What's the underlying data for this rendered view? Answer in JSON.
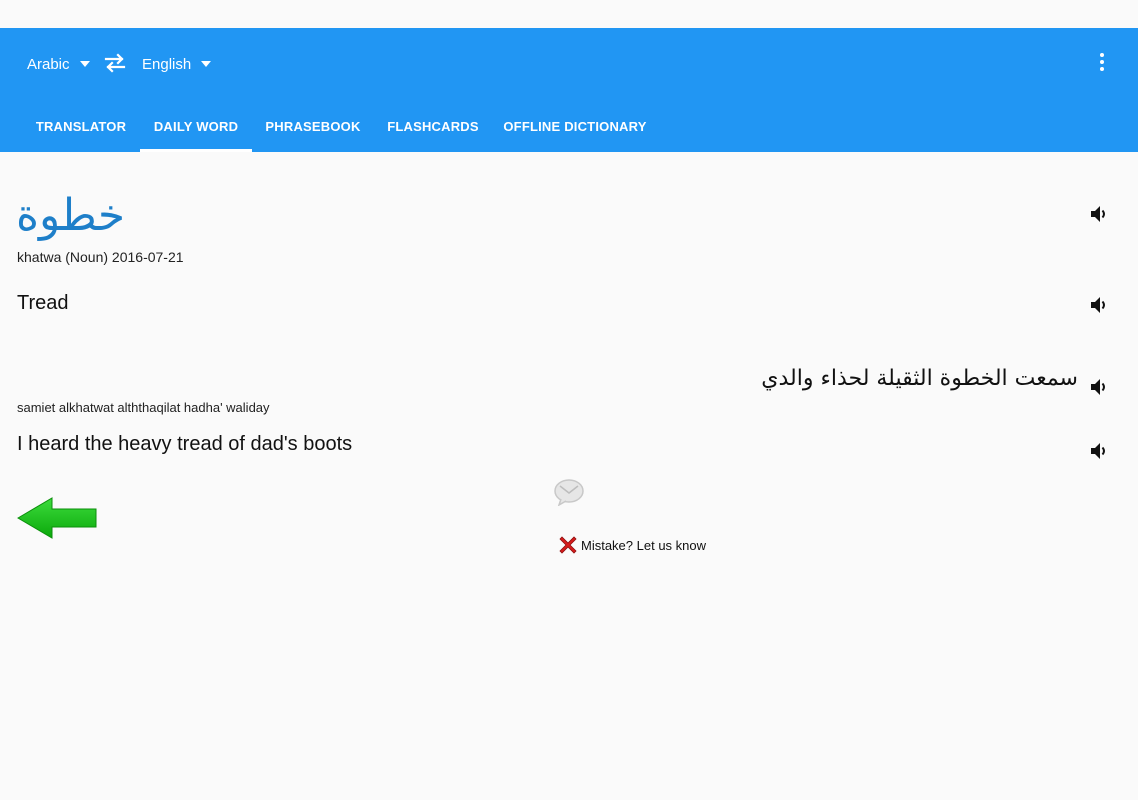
{
  "header": {
    "source_language": "Arabic",
    "target_language": "English",
    "swap_icon": "swap-arrows-icon",
    "overflow_icon": "more-vert-icon",
    "accent_color": "#2196f3"
  },
  "tabs": [
    {
      "label": "TRANSLATOR",
      "active": false
    },
    {
      "label": "DAILY WORD",
      "active": true
    },
    {
      "label": "PHRASEBOOK",
      "active": false
    },
    {
      "label": "FLASHCARDS",
      "active": false
    },
    {
      "label": "OFFLINE DICTIONARY",
      "active": false
    }
  ],
  "daily_word": {
    "word": "خطوة",
    "meta": "khatwa (Noun) 2016-07-21",
    "translation": "Tread",
    "example_arabic": "سمعت الخطوة الثقيلة لحذاء والدي",
    "example_transliteration": "samiet alkhatwat alththaqilat hadha' waliday",
    "example_english": "I heard the heavy tread of dad's boots",
    "speaker_icon": "speaker-icon",
    "word_color": "#1e7fc9"
  },
  "footer": {
    "back_icon": "green-left-arrow-icon",
    "feedback_icon": "speech-bubble-icon",
    "mistake_icon": "red-x-icon",
    "mistake_label": "Mistake? Let us know"
  }
}
